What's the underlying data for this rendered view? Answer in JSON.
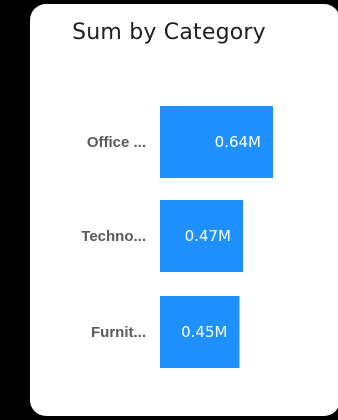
{
  "colors": {
    "bar": "#1e90ff",
    "card": "#ffffff",
    "background": "#000000"
  },
  "chart_data": {
    "type": "bar",
    "orientation": "horizontal",
    "title": "Sum by Category",
    "categories": [
      "Office ...",
      "Techno...",
      "Furnit..."
    ],
    "values": [
      0.64,
      0.47,
      0.45
    ],
    "value_labels": [
      "0.64M",
      "0.47M",
      "0.45M"
    ],
    "xlim": [
      0,
      0.64
    ],
    "grid": false,
    "legend": "none"
  }
}
